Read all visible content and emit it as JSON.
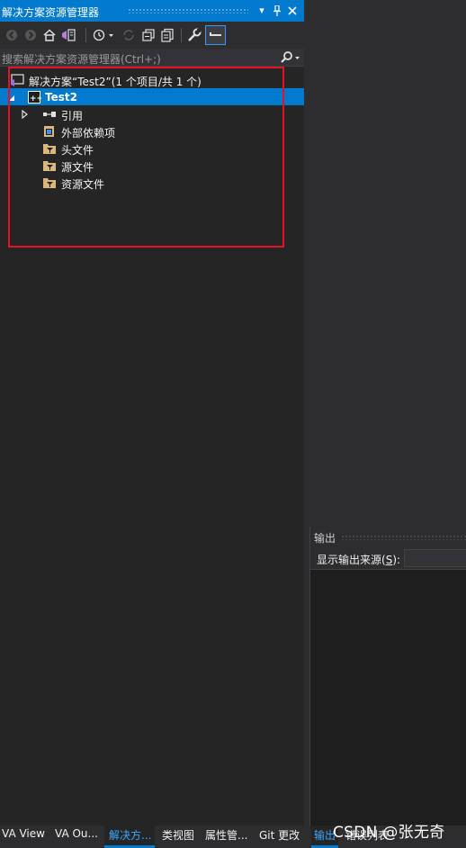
{
  "solution_explorer": {
    "title": "解决方案资源管理器",
    "title_buttons": {
      "dropdown": "▾",
      "pin": "⊥",
      "close": "✕"
    },
    "search_placeholder": "搜索解决方案资源管理器(Ctrl+;)",
    "tree": {
      "solution": "解决方案“Test2”(1 个项目/共 1 个)",
      "project": "Test2",
      "items": [
        "引用",
        "外部依赖项",
        "头文件",
        "源文件",
        "资源文件"
      ]
    }
  },
  "output_panel": {
    "title": "输出",
    "show_output_from_prefix": "显示输出来源(",
    "show_output_from_key": "S",
    "show_output_from_suffix": "):"
  },
  "bottom_tabs": {
    "left": [
      "VA View",
      "VA Ou...",
      "解决方...",
      "类视图",
      "属性管...",
      "Git 更改"
    ],
    "active_index": 2,
    "right": [
      "输出",
      "错误列表"
    ]
  },
  "watermark": "CSDN @张无奇",
  "colors": {
    "accent": "#007acc",
    "panel": "#252526",
    "chrome": "#2d2d30",
    "highlight_border": "#e81123"
  }
}
